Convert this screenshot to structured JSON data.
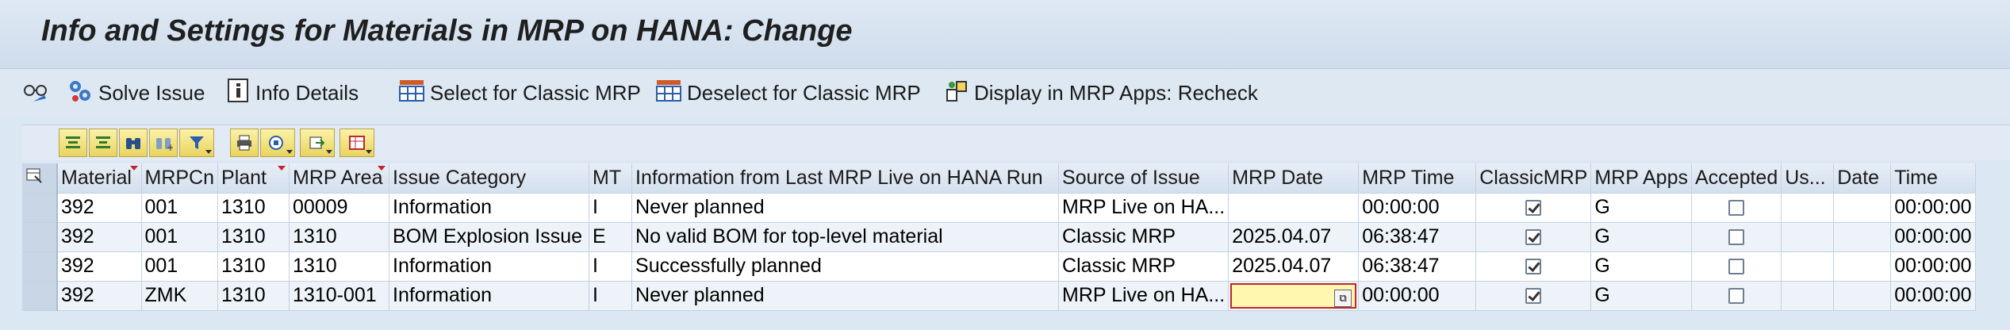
{
  "window": {
    "title": "Info and Settings for Materials in MRP on HANA: Change"
  },
  "toolbar": {
    "items": [
      {
        "label": "Solve Issue",
        "icon": "gear-cluster-icon"
      },
      {
        "label": "Info Details",
        "icon": "info-icon"
      },
      {
        "label": "Select for Classic MRP",
        "icon": "select-all-icon"
      },
      {
        "label": "Deselect for Classic MRP",
        "icon": "deselect-all-icon"
      },
      {
        "label": "Display in MRP Apps: Recheck",
        "icon": "recheck-icon"
      }
    ]
  },
  "grid_toolbar": {
    "buttons": [
      "align-top-icon",
      "align-center-icon",
      "binoculars-icon",
      "find-next-icon",
      "filter-icon",
      "print-icon",
      "views-icon",
      "export-icon",
      "layout-icon"
    ]
  },
  "grid": {
    "columns": [
      "Material",
      "MRPCn",
      "Plant",
      "MRP Area",
      "Issue Category",
      "MT",
      "Information from Last MRP Live on HANA Run",
      "Source of Issue",
      "MRP Date",
      "MRP Time",
      "ClassicMRP",
      "MRP Apps",
      "Accepted",
      "Us...",
      "Date",
      "Time"
    ],
    "rows": [
      {
        "material": "392",
        "mrpcn": "001",
        "plant": "1310",
        "mrp_area": "00009",
        "issue_category": "Information",
        "mt": "I",
        "info": "Never planned",
        "source": "MRP Live on HA...",
        "mrp_date": "",
        "mrp_time": "00:00:00",
        "classic_mrp": true,
        "mrp_apps": "G",
        "accepted": false,
        "user": "",
        "date": "",
        "time": "00:00:00"
      },
      {
        "material": "392",
        "mrpcn": "001",
        "plant": "1310",
        "mrp_area": "1310",
        "issue_category": "BOM Explosion Issue",
        "mt": "E",
        "info": "No valid BOM for top-level material",
        "source": "Classic MRP",
        "mrp_date": "2025.04.07",
        "mrp_time": "06:38:47",
        "classic_mrp": true,
        "mrp_apps": "G",
        "accepted": false,
        "user": "",
        "date": "",
        "time": "00:00:00"
      },
      {
        "material": "392",
        "mrpcn": "001",
        "plant": "1310",
        "mrp_area": "1310",
        "issue_category": "Information",
        "mt": "I",
        "info": "Successfully planned",
        "source": "Classic MRP",
        "mrp_date": "2025.04.07",
        "mrp_time": "06:38:47",
        "classic_mrp": true,
        "mrp_apps": "G",
        "accepted": false,
        "user": "",
        "date": "",
        "time": "00:00:00"
      },
      {
        "material": "392",
        "mrpcn": "ZMK",
        "plant": "1310",
        "mrp_area": "1310-001",
        "issue_category": "Information",
        "mt": "I",
        "info": "Never planned",
        "source": "MRP Live on HA...",
        "mrp_date": "",
        "mrp_time": "00:00:00",
        "classic_mrp": true,
        "mrp_apps": "G",
        "accepted": false,
        "user": "",
        "date": "",
        "time": "00:00:00"
      }
    ]
  }
}
